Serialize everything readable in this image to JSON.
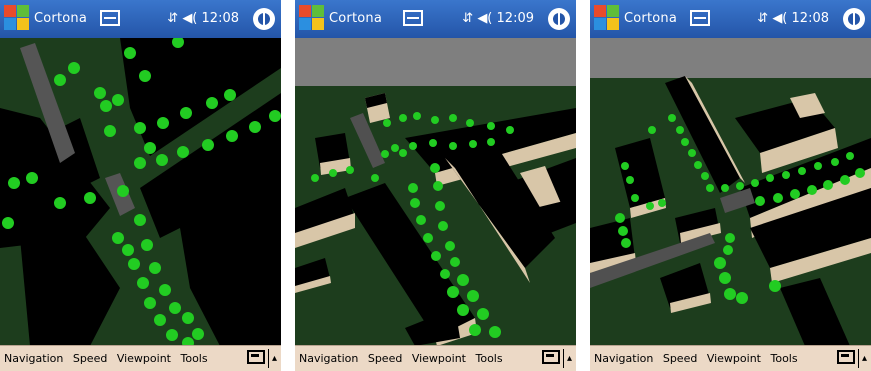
{
  "colors": {
    "titlebar": "#2f66bd",
    "grass": "#1d3d1d",
    "building_roof": "#000000",
    "building_wall": "#d8c6a8",
    "tree": "#22cc22",
    "road": "#505050",
    "sky": "#7f7f7f",
    "menubar": "#ecd9c6"
  },
  "screens": [
    {
      "title": "Cortona",
      "time": "12:08",
      "menu": [
        "Navigation",
        "Speed",
        "Viewpoint",
        "Tools"
      ]
    },
    {
      "title": "Cortona",
      "time": "12:09",
      "menu": [
        "Navigation",
        "Speed",
        "Viewpoint",
        "Tools"
      ]
    },
    {
      "title": "Cortona",
      "time": "12:08",
      "menu": [
        "Navigation",
        "Speed",
        "Viewpoint",
        "Tools"
      ]
    }
  ]
}
